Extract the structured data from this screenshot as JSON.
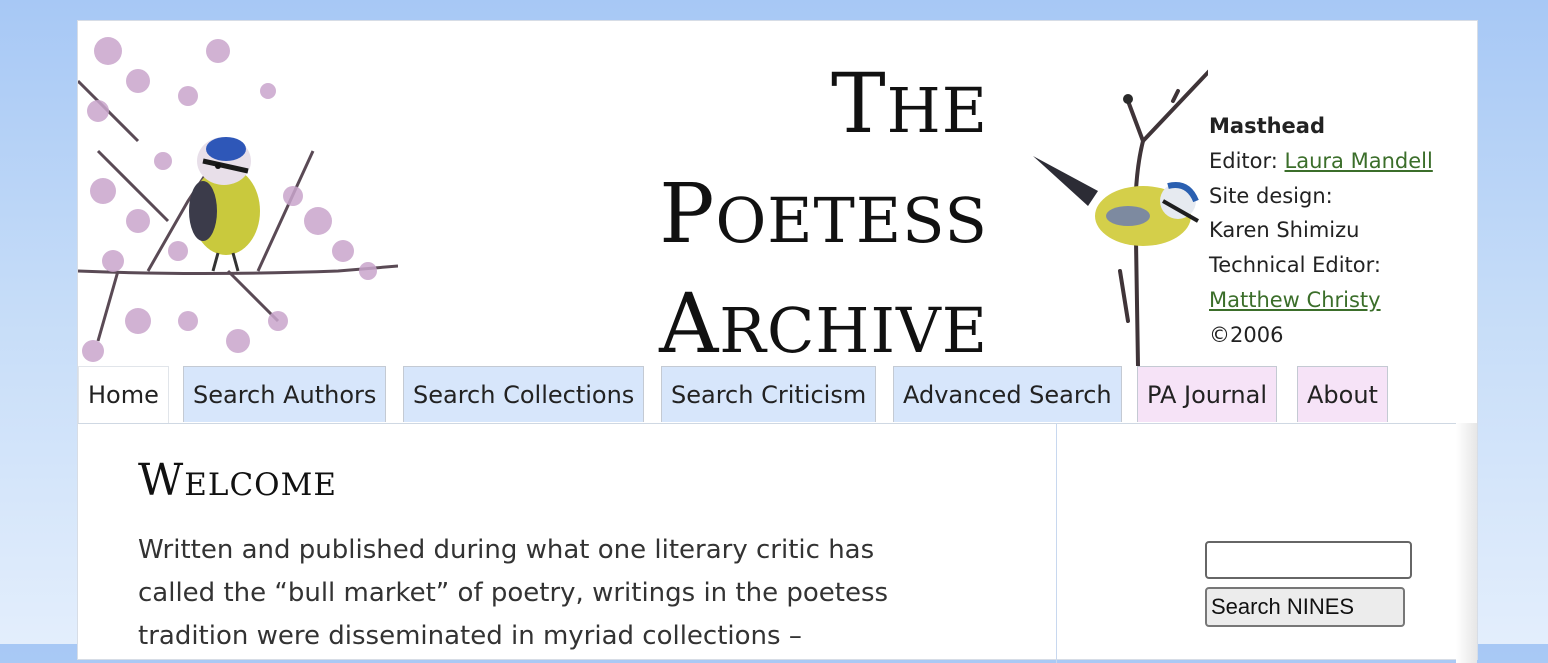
{
  "logo": {
    "line1_first": "T",
    "line1_rest": "HE",
    "line2_first": "P",
    "line2_rest": "OETESS",
    "line3_first": "A",
    "line3_rest": "RCHIVE"
  },
  "masthead": {
    "title": "Masthead",
    "editor_label": "Editor: ",
    "editor_link": "Laura Mandell",
    "design_label": "Site design:",
    "design_name": "Karen Shimizu",
    "tech_label": "Technical Editor:",
    "tech_link": "Matthew Christy",
    "copyright": "©2006"
  },
  "tabs": {
    "home": "Home",
    "authors": "Search Authors",
    "collections": "Search Collections",
    "criticism": "Search Criticism",
    "advanced": "Advanced Search",
    "journal": "PA Journal",
    "about": "About"
  },
  "main": {
    "heading_first": "W",
    "heading_rest": "ELCOME",
    "para_l1": "Written and published during what one literary critic has",
    "para_l2": "called the “bull market” of poetry, writings in the poetess",
    "para_l3": "tradition were disseminated in myriad collections –"
  },
  "search": {
    "button_label": "Search NINES",
    "value": ""
  },
  "colors": {
    "link": "#3b6e2a",
    "tab_blue": "#d7e6fb",
    "tab_pink": "#f6e3f7",
    "background": "#a7c8f5"
  },
  "icons": {
    "left_art": "blue-tit-on-blossom-branch",
    "right_art": "blue-tit-on-twig"
  }
}
